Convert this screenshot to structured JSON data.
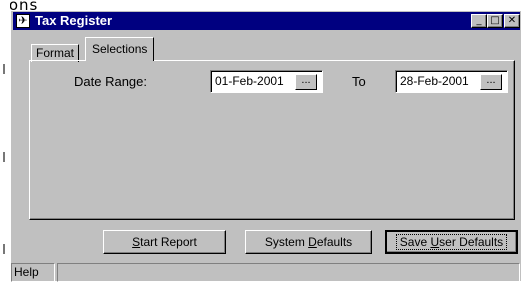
{
  "background": {
    "partial_text": "rons"
  },
  "window": {
    "title": "Tax Register",
    "app_icon_glyph": "✈",
    "controls": {
      "minimize": "_",
      "maximize": "□",
      "close": "✕"
    }
  },
  "tabs": [
    {
      "label": "Format"
    },
    {
      "label": "Selections"
    }
  ],
  "selections": {
    "date_range_label": "Date Range:",
    "from_value": "01-Feb-2001",
    "to_label": "To",
    "to_value": "28-Feb-2001",
    "lookup_label": "..."
  },
  "buttons": {
    "start_report": {
      "pre": "",
      "accel": "S",
      "post": "tart Report"
    },
    "system_defaults": {
      "pre": "System ",
      "accel": "D",
      "post": "efaults"
    },
    "save_user_defaults": {
      "pre": "Save ",
      "accel": "U",
      "post": "ser Defaults"
    }
  },
  "statusbar": {
    "help": "Help"
  },
  "colors": {
    "titlebar": "#000080",
    "face": "#c0c0c0"
  }
}
